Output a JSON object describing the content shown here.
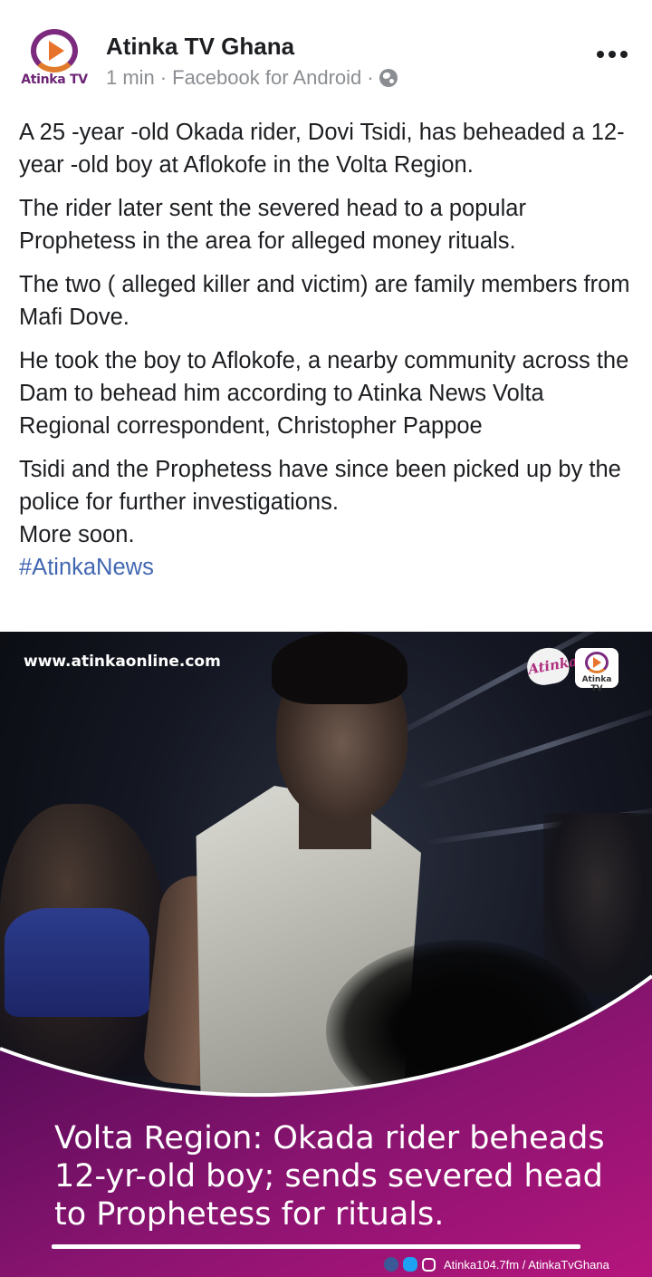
{
  "post": {
    "page_name": "Atinka TV Ghana",
    "avatar_label": "Atinka TV",
    "time": "1 min",
    "separator": "·",
    "source": "Facebook for Android",
    "privacy_icon": "globe-icon",
    "more_icon": "more-horizontal-icon"
  },
  "body": {
    "paragraphs": [
      "A 25 -year -old Okada rider, Dovi Tsidi, has beheaded a 12- year -old boy at Aflokofe in the Volta Region.",
      "The rider later sent the severed head to a popular Prophetess in the area for alleged money rituals.",
      "The two ( alleged killer and victim) are family members from Mafi Dove.",
      "He took the boy to Aflokofe, a nearby community across the Dam to behead him according to Atinka News Volta Regional correspondent, Christopher Pappoe",
      "Tsidi and the Prophetess have since been picked up by the police for further investigations.",
      "More soon."
    ],
    "hashtag": "#AtinkaNews"
  },
  "image": {
    "site_url": "www.atinkaonline.com",
    "logo_fm_text": "Atinka",
    "logo_tv_text": "Atinka TV",
    "headline": "Volta Region: Okada rider beheads 12-yr-old boy; sends severed head to Prophetess for rituals.",
    "social_handles": "Atinka104.7fm / AtinkaTvGhana",
    "colors": {
      "banner_dark": "#4a0a52",
      "banner_light": "#b5157d",
      "accent_orange": "#e8732a",
      "brand_purple": "#7b2a7e",
      "hashtag_blue": "#4267b2"
    }
  }
}
